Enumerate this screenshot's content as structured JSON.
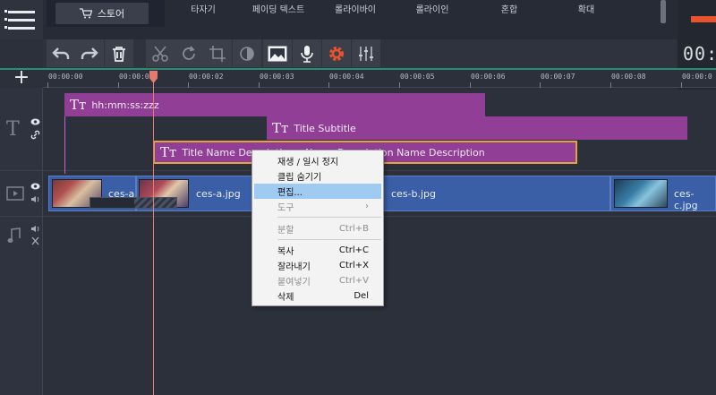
{
  "toolbar_top": {
    "store_label": "스토어",
    "tabs": [
      "타자기",
      "페이딩 텍스트",
      "롤라이바이",
      "롤라이인",
      "혼합",
      "확대"
    ],
    "time_display": "00:0"
  },
  "ruler": {
    "ticks": [
      "00:00:00",
      "00:00:01",
      "00:00:02",
      "00:00:03",
      "00:00:04",
      "00:00:05",
      "00:00:06",
      "00:00:07",
      "00:00:08",
      "00:00:0"
    ]
  },
  "title_track": {
    "clips": [
      {
        "label": "hh:mm:ss:zzz",
        "icon": "Tт"
      },
      {
        "label": "Title Subtitle",
        "icon": "Tт"
      },
      {
        "label": "Title Name Description",
        "tail": "Name Description Name Description",
        "icon": "Tт"
      }
    ]
  },
  "video_track": {
    "clips": [
      {
        "label": "ces-a"
      },
      {
        "label": "ces-a.jpg"
      },
      {
        "label": "ces-b.jpg"
      },
      {
        "label": "ces-c.jpg"
      }
    ]
  },
  "context_menu": {
    "items": [
      {
        "label": "재생 / 일시 정지",
        "shortcut": "",
        "state": "normal"
      },
      {
        "label": "클립 숨기기",
        "shortcut": "",
        "state": "normal"
      },
      {
        "label": "편집...",
        "shortcut": "",
        "state": "selected"
      },
      {
        "label": "도구",
        "shortcut": "›",
        "state": "disabled"
      },
      {
        "label": "분할",
        "shortcut": "Ctrl+B",
        "state": "disabled"
      },
      {
        "label": "복사",
        "shortcut": "Ctrl+C",
        "state": "normal"
      },
      {
        "label": "잘라내기",
        "shortcut": "Ctrl+X",
        "state": "normal"
      },
      {
        "label": "붙여넣기",
        "shortcut": "Ctrl+V",
        "state": "disabled"
      },
      {
        "label": "삭제",
        "shortcut": "Del",
        "state": "normal"
      }
    ]
  },
  "colors": {
    "title_clip": "#913f96",
    "video_clip": "#3a5fa6",
    "playhead": "#e57a6f",
    "accent_orange": "#e8532e",
    "menu_highlight": "#9fcbf2"
  }
}
